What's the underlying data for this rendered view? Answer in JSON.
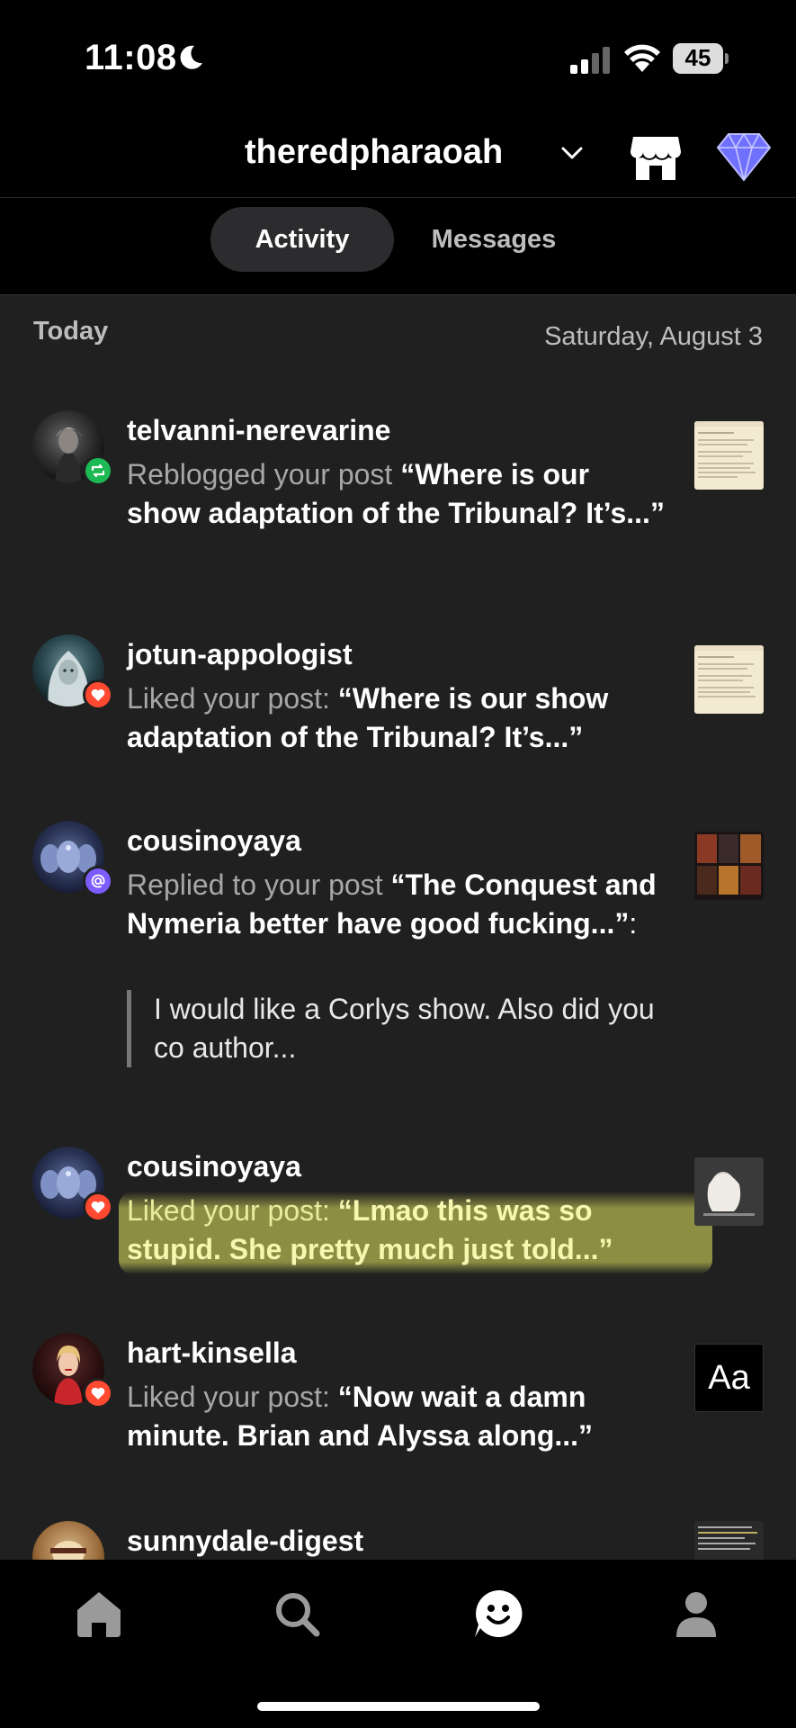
{
  "status_bar": {
    "time": "11:08",
    "battery": "45"
  },
  "header": {
    "blog_name": "theredpharaoah"
  },
  "tabs": [
    {
      "label": "Activity",
      "selected": true
    },
    {
      "label": "Messages",
      "selected": false
    }
  ],
  "feed": {
    "day_label": "Today",
    "date_label": "Saturday, August 3",
    "items": [
      {
        "username": "telvanni-nerevarine",
        "action": "Reblogged your post",
        "excerpt": "Where is our show adaptation of the Tribunal? It’s...",
        "badge": "reblog-icon",
        "badge_color": "#1db954"
      },
      {
        "username": "jotun-appologist",
        "action": "Liked your post:",
        "excerpt": "Where is our show adaptation of the Tribunal? It’s...",
        "badge": "heart-icon",
        "badge_color": "#ff4930"
      },
      {
        "username": "cousinoyaya",
        "action": "Replied to your post",
        "excerpt": "The Conquest and Nymeria better have good fucking...",
        "reply": "I would like a Corlys show. Also did you co author...",
        "badge": "mention-icon",
        "badge_color": "#7c5cff"
      },
      {
        "username": "cousinoyaya",
        "action": "Liked your post:",
        "excerpt": "Lmao this was so stupid. She pretty much just told...",
        "badge": "heart-icon",
        "badge_color": "#ff4930",
        "highlighted": true
      },
      {
        "username": "hart-kinsella",
        "action": "Liked your post:",
        "excerpt": "Now wait a damn minute. Brian and Alyssa along...",
        "badge": "heart-icon",
        "badge_color": "#ff4930",
        "thumb_text": "Aa"
      },
      {
        "username": "sunnydale-digest"
      }
    ]
  },
  "tabbar": [
    {
      "icon": "home-icon"
    },
    {
      "icon": "search-icon"
    },
    {
      "icon": "activity-smiley-icon",
      "selected": true
    },
    {
      "icon": "account-icon"
    }
  ],
  "colors": {
    "background": "#202020",
    "accent_green": "#1db954",
    "accent_red": "#ff4930",
    "accent_purple": "#7c5cff",
    "gem": "#6c6cff"
  }
}
